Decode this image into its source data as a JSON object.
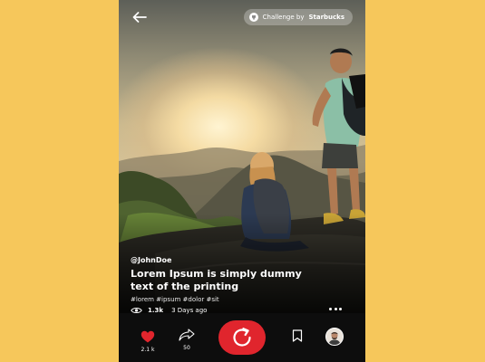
{
  "header": {
    "back_icon": "arrow-left-icon",
    "challenge_prefix": "Challenge by",
    "challenge_brand": "Starbucks"
  },
  "post": {
    "username": "@JohnDoe",
    "caption": "Lorem Ipsum is simply dummy text of the printing",
    "hashtags": "#lorem #ipsum #dolor #sit",
    "views": "1.3k",
    "posted": "3 Days ago"
  },
  "actions": {
    "likes": "2.1 k",
    "shares": "50"
  },
  "colors": {
    "background": "#f6c75b",
    "accent": "#e0252d",
    "like": "#e0252d"
  }
}
